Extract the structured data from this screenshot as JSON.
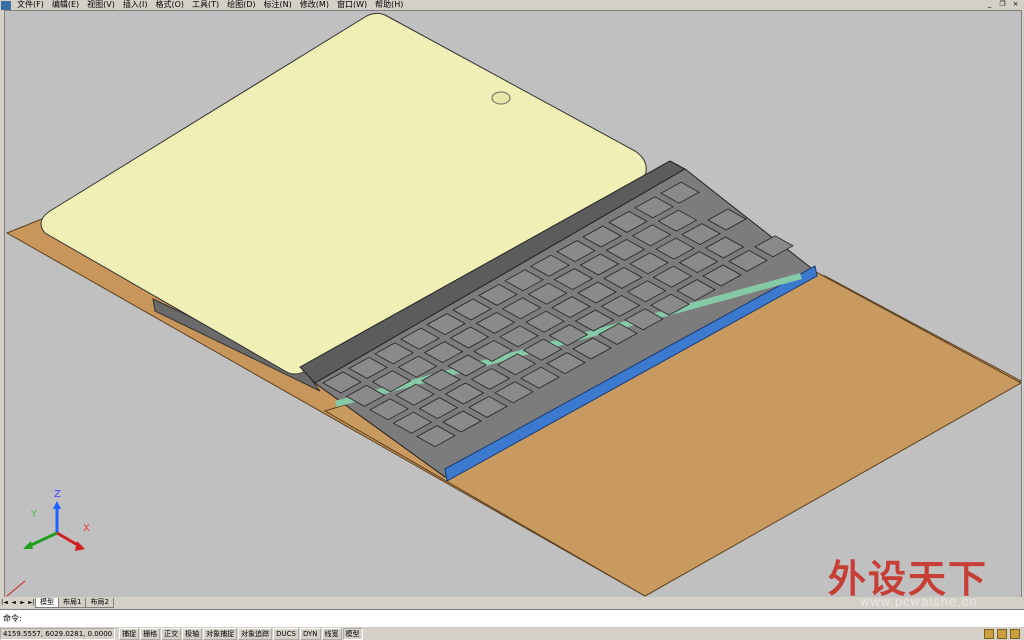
{
  "menubar": {
    "items": [
      "文件(F)",
      "编辑(E)",
      "视图(V)",
      "插入(I)",
      "格式(O)",
      "工具(T)",
      "绘图(D)",
      "标注(N)",
      "修改(M)",
      "窗口(W)",
      "帮助(H)"
    ]
  },
  "window_controls": {
    "minimize": "_",
    "restore": "❐",
    "close": "×"
  },
  "viewport": {
    "ucs": {
      "z_label": "Z",
      "y_label": "Y",
      "x_label": "X"
    },
    "colors": {
      "background": "#c0c0c0",
      "screen": "#f0efb6",
      "cover": "#c8965a",
      "key": "#8a8a8a",
      "strip": "#3c7ad0"
    }
  },
  "tabs": {
    "nav": [
      "|◄",
      "◄",
      "►",
      "►|"
    ],
    "items": [
      "模型",
      "布局1",
      "布局2"
    ]
  },
  "cmdline": {
    "prompt": "命令:"
  },
  "statusbar": {
    "coords": "4159.5557, 6029.0281, 0.0000",
    "buttons": [
      "捕捉",
      "栅格",
      "正交",
      "极轴",
      "对象捕捉",
      "对象追踪",
      "DUCS",
      "DYN",
      "线宽",
      "模型"
    ]
  },
  "watermark": {
    "title": "外设天下",
    "url": "www.pcwaishe.cn"
  }
}
